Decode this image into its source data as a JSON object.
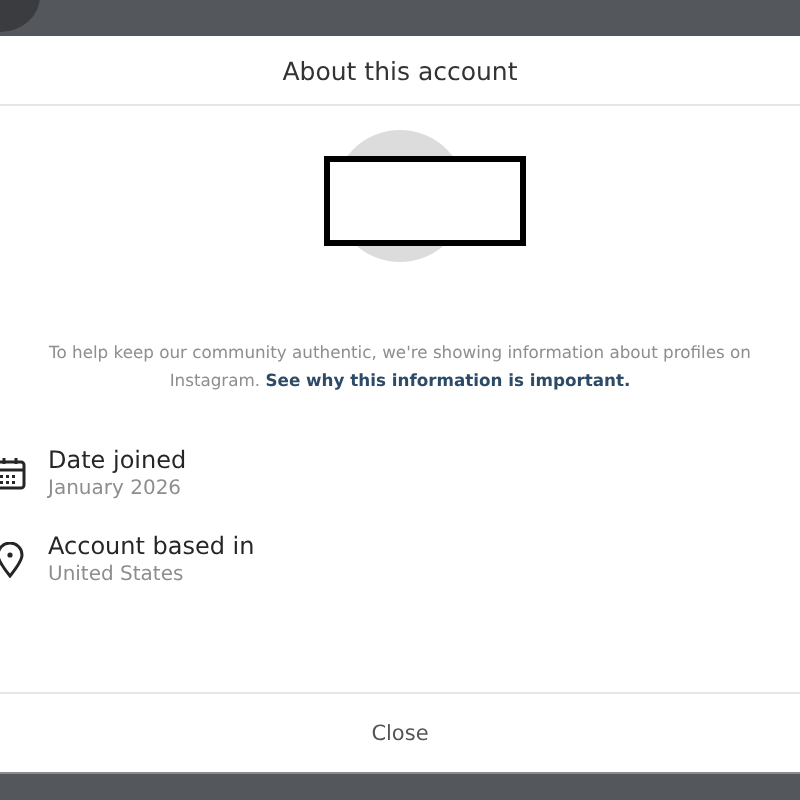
{
  "dialog": {
    "title": "About this account",
    "notice": "To help keep our community authentic, we're showing information about profiles on Instagram.",
    "notice_link": "See why this information is important.",
    "details": [
      {
        "kind": "calendar",
        "label": "Date joined",
        "value": "January 2026"
      },
      {
        "kind": "location",
        "label": "Account based in",
        "value": "United States"
      }
    ],
    "close_button": "Close"
  }
}
